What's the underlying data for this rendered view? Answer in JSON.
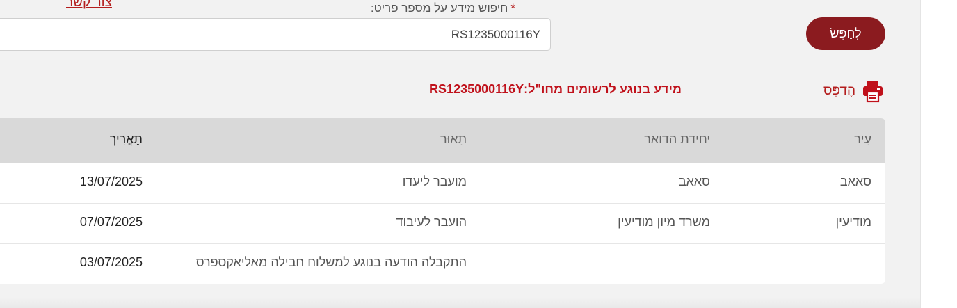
{
  "header": {
    "contact_link": "צור קשר"
  },
  "search": {
    "required_marker": "*",
    "label": "חיפוש מידע על מספר פריט:",
    "value": "RS1235000116Y",
    "button_label": "לְחַפֵּשׂ"
  },
  "result": {
    "print_label": "הֶדפֵּס",
    "title": "מידע בנוגע לרשומים מחו\"ל:RS1235000116Y"
  },
  "table": {
    "columns": {
      "city": "עִיר",
      "postal_unit": "יחידת הדואר",
      "description": "תֵאוּר",
      "date": "תַאֲרִיך"
    },
    "rows": [
      {
        "city": "סאאב",
        "postal_unit": "סאאב",
        "description": "מועבר ליעדו",
        "date": "13/07/2025"
      },
      {
        "city": "מודיעין",
        "postal_unit": "משרד מיון מודיעין",
        "description": "הועבר לעיבוד",
        "date": "07/07/2025"
      },
      {
        "city": "",
        "postal_unit": "",
        "description": "התקבלה הודעה בנוגע למשלוח חבילה מאליאקספרס",
        "date": "03/07/2025"
      }
    ]
  },
  "icons": {
    "print": "printer-icon"
  },
  "colors": {
    "brand": "#8b1b1f",
    "accent_text": "#c0111b",
    "header_bg": "#d9d9d9"
  }
}
